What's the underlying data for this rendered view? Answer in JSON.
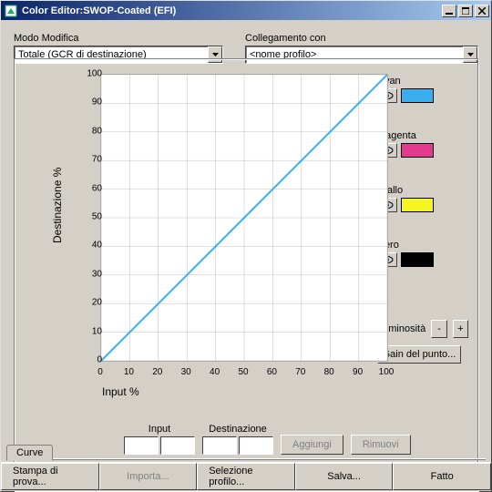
{
  "title": "Color Editor:SWOP-Coated (EFI)",
  "modo_label": "Modo Modifica",
  "modo_value": "Totale (GCR di destinazione)",
  "colleg_label": "Collegamento con",
  "colleg_value": "<nome profilo>",
  "chart_data": {
    "type": "line",
    "x": [
      0,
      10,
      20,
      30,
      40,
      50,
      60,
      70,
      80,
      90,
      100
    ],
    "y": [
      0,
      10,
      20,
      30,
      40,
      50,
      60,
      70,
      80,
      90,
      100
    ],
    "xlabel": "Input %",
    "ylabel": "Destinazione %",
    "xticks": [
      0,
      10,
      20,
      30,
      40,
      50,
      60,
      70,
      80,
      90,
      100
    ],
    "yticks": [
      0,
      10,
      20,
      30,
      40,
      50,
      60,
      70,
      80,
      90,
      100
    ],
    "xlim": [
      0,
      100
    ],
    "ylim": [
      0,
      100
    ]
  },
  "channels": [
    {
      "name": "Cyan",
      "color": "#3aaff0"
    },
    {
      "name": "Magenta",
      "color": "#e23a8c"
    },
    {
      "name": "Giallo",
      "color": "#f5f521"
    },
    {
      "name": "Nero",
      "color": "#000000"
    }
  ],
  "lum_label": "Luminosità",
  "gain_label": "Gain del punto...",
  "input_label": "Input",
  "dest_label": "Destinazione",
  "add_label": "Aggiungi",
  "remove_label": "Rimuovi",
  "tab_curve": "Curve",
  "footer": {
    "proof": "Stampa di prova...",
    "import": "Importa...",
    "select": "Selezione profilo...",
    "save": "Salva...",
    "done": "Fatto"
  },
  "btn_minus": "-",
  "btn_plus": "+"
}
